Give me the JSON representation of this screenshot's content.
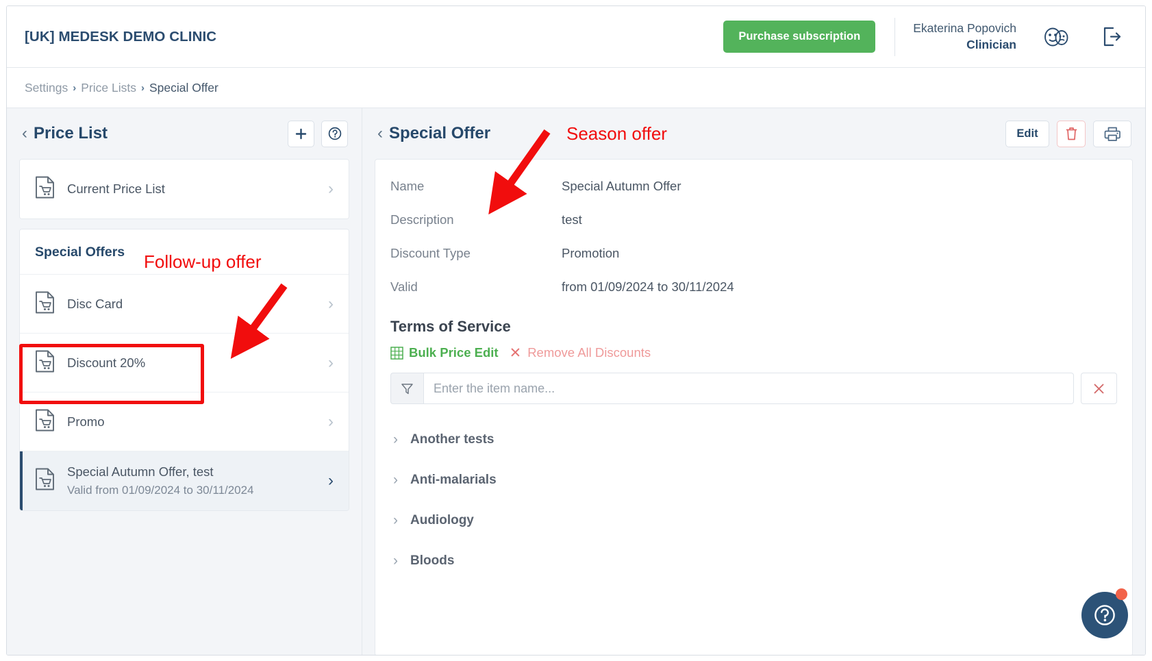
{
  "header": {
    "clinic_title": "[UK] MEDESK DEMO CLINIC",
    "purchase_label": "Purchase subscription",
    "user_name": "Ekaterina Popovich",
    "user_role": "Clinician",
    "masks_icon": "theater-masks-icon",
    "logout_icon": "logout-icon"
  },
  "breadcrumb": {
    "settings": "Settings",
    "price_lists": "Price Lists",
    "current": "Special Offer",
    "separator": "›"
  },
  "left_panel": {
    "title": "Price List",
    "back_chevron": "‹",
    "add_label": "+",
    "help_icon": "question-circle-icon",
    "price_list_items": [
      {
        "label": "Current Price List"
      }
    ],
    "section_title": "Special Offers",
    "offers": [
      {
        "label": "Disc Card",
        "sub": "",
        "selected": false
      },
      {
        "label": "Discount 20%",
        "sub": "",
        "selected": false
      },
      {
        "label": "Promo",
        "sub": "",
        "selected": false
      },
      {
        "label": "Special Autumn Offer, test",
        "sub": "Valid from 01/09/2024 to 30/11/2024",
        "selected": true
      }
    ]
  },
  "annotations": {
    "follow_up": "Follow-up offer",
    "season": "Season offer",
    "color": "#f10d0d"
  },
  "right_panel": {
    "title": "Special Offer",
    "back_chevron": "‹",
    "edit_label": "Edit",
    "delete_icon": "trash-icon",
    "print_icon": "printer-icon",
    "fields": [
      {
        "label": "Name",
        "value": "Special Autumn Offer"
      },
      {
        "label": "Description",
        "value": "test"
      },
      {
        "label": "Discount Type",
        "value": "Promotion"
      },
      {
        "label": "Valid",
        "value": "from 01/09/2024 to 30/11/2024"
      }
    ],
    "terms_title": "Terms of Service",
    "bulk_edit_label": "Bulk Price Edit",
    "bulk_edit_icon": "table-grid-icon",
    "remove_all_label": "Remove All Discounts",
    "remove_all_icon": "x-icon",
    "filter_icon": "funnel-filter-icon",
    "filter_placeholder": "Enter the item name...",
    "filter_value": "",
    "filter_clear_icon": "x-icon",
    "categories": [
      {
        "label": "Another tests"
      },
      {
        "label": "Anti-malarials"
      },
      {
        "label": "Audiology"
      },
      {
        "label": "Bloods"
      }
    ]
  },
  "help_fab": {
    "icon": "question-circle-icon",
    "badge": true
  },
  "colors": {
    "accent_green": "#53b35b",
    "brand_navy": "#27496b",
    "danger_red": "#e57373",
    "annotation_red": "#f10d0d",
    "bulk_green": "#4caf50"
  }
}
